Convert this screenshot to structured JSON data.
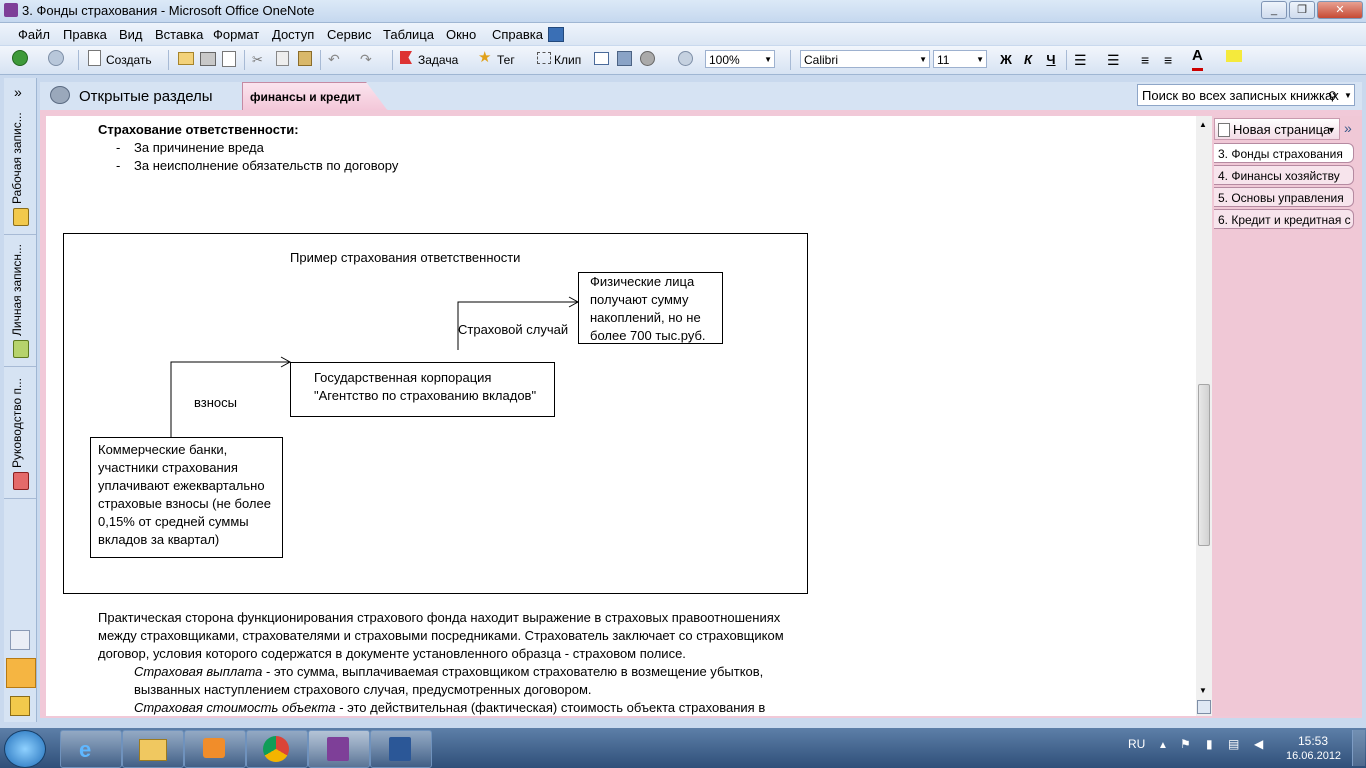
{
  "window": {
    "title": "3. Фонды страхования - Microsoft Office OneNote",
    "min": "_",
    "max": "❐",
    "close": "✕"
  },
  "menu": [
    "Файл",
    "Правка",
    "Вид",
    "Вставка",
    "Формат",
    "Доступ",
    "Сервис",
    "Таблица",
    "Окно",
    "Справка"
  ],
  "toolbar": {
    "create": "Создать",
    "task": "Задача",
    "tag": "Тег",
    "clip": "Клип",
    "zoom": "100%",
    "font": "Calibri",
    "size": "11",
    "bold": "Ж",
    "italic": "К",
    "underline": "Ч"
  },
  "nav": {
    "book1": "Рабочая запис...",
    "book2": "Личная записн...",
    "book3": "Руководство п...",
    "expand": "»"
  },
  "tabs": {
    "open_sections": "Открытые разделы",
    "active": "финансы и кредит",
    "search_placeholder": "Поиск во всех записных книжках"
  },
  "pages": {
    "new_page": "Новая страница",
    "list": [
      "3. Фонды страхования",
      "4. Финансы хозяйству",
      "5. Основы управления",
      "6. Кредит и кредитная с"
    ]
  },
  "content": {
    "heading": "Страхование ответственности",
    "heading_colon": ":",
    "bullets": [
      "За причинение вреда",
      "За неисполнение обязательств по договору"
    ],
    "diagram": {
      "title": "Пример страхования ответственности",
      "box_individuals": "Физические лица\nполучают сумму\nнакоплений, но не\nболее 700 тыс.руб.",
      "label_event": "Страховой случай",
      "box_agency": "Государственная корпорация\n\"Агентство по страхованию вкладов\"",
      "label_fees": "взносы",
      "box_banks": "Коммерческие банки,\nучастники страхования\nуплачивают ежеквартально\nстраховые взносы (не более\n0,15% от средней суммы\nвкладов за квартал)"
    },
    "para_lines": [
      "Практическая сторона функционирования страхового фонда находит выражение в страховых правоотношениях",
      "между страховщиками, страхователями и страховыми посредниками. Страхователь заключает со страховщиком",
      "договор, условия которого содержатся в документе установленного образца - страховом полисе."
    ],
    "def1_term": "Страховая выплата",
    "def1_rest": " - это сумма, выплачиваемая страховщиком страхователю в возмещение убытков,",
    "def1_line2": "вызванных наступлением страхового случая, предусмотренных договором.",
    "def2_term": "Страховая стоимость объекта",
    "def2_rest": " - это действительная (фактическая) стоимость объекта страхования в"
  },
  "tray": {
    "lang": "RU",
    "time": "15:53",
    "date": "16.06.2012"
  }
}
